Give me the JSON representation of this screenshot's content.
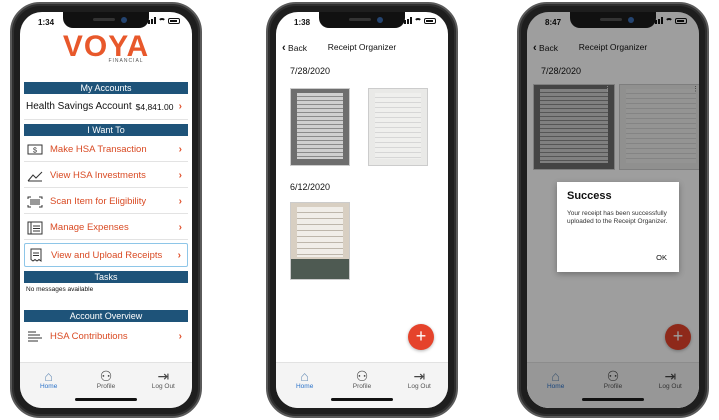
{
  "phone1": {
    "status_time": "1:34",
    "logo_main": "VOYA",
    "logo_sub": "FINANCIAL",
    "my_accounts_header": "My Accounts",
    "account_label": "Health Savings Account",
    "account_balance": "$4,841.00",
    "i_want_to_header": "I Want To",
    "menu": [
      {
        "label": "Make HSA Transaction",
        "icon": "dollar-bill-icon"
      },
      {
        "label": "View HSA Investments",
        "icon": "line-graph-icon"
      },
      {
        "label": "Scan Item for Eligibility",
        "icon": "barcode-icon"
      },
      {
        "label": "Manage Expenses",
        "icon": "list-icon"
      },
      {
        "label": "View and Upload Receipts",
        "icon": "receipt-icon"
      }
    ],
    "tasks_header": "Tasks",
    "tasks_message": "No messages available",
    "overview_header": "Account Overview",
    "overview_item": "HSA Contributions",
    "tabs": {
      "home": "Home",
      "profile": "Profile",
      "logout": "Log Out"
    },
    "colors": {
      "brand": "#e8582b",
      "header": "#1e5379",
      "active_tab": "#2a72c9"
    }
  },
  "phone2": {
    "status_time": "1:38",
    "back_label": "Back",
    "title": "Receipt Organizer",
    "date1": "7/28/2020",
    "date2": "6/12/2020",
    "fab_label": "+",
    "tabs": {
      "home": "Home",
      "profile": "Profile",
      "logout": "Log Out"
    }
  },
  "phone3": {
    "status_time": "8:47",
    "back_label": "Back",
    "title": "Receipt Organizer",
    "date1": "7/28/2020",
    "dialog_title": "Success",
    "dialog_message": "Your receipt has been successfully uploaded to the Receipt Organizer.",
    "dialog_ok": "OK",
    "fab_label": "+",
    "tabs": {
      "home": "Home",
      "profile": "Profile",
      "logout": "Log Out"
    }
  }
}
